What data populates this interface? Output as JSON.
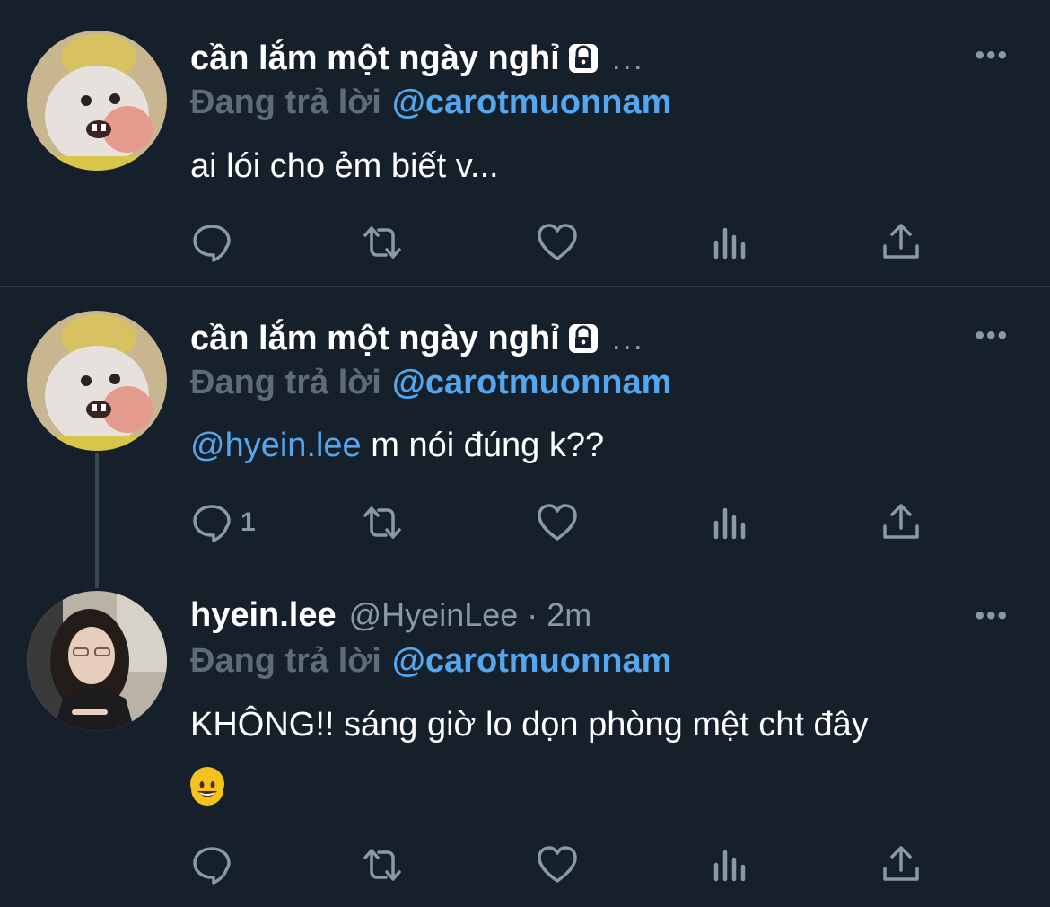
{
  "tweets": [
    {
      "name": "cần lắm một ngày nghỉ",
      "meta": "...",
      "reply_label": "Đang trả lời",
      "reply_handle": "@carotmuonnam",
      "mention": "",
      "text": "ai lói cho ẻm biết v...",
      "reply_count": ""
    },
    {
      "name": "cần lắm một ngày nghỉ",
      "meta": "...",
      "reply_label": "Đang trả lời",
      "reply_handle": "@carotmuonnam",
      "mention": "@hyein.lee",
      "text": "m nói đúng k??",
      "reply_count": "1"
    },
    {
      "name": "hyein.lee",
      "handle": "@HyeinLee · 2m",
      "reply_label": "Đang trả lời",
      "reply_handle": "@carotmuonnam",
      "text": "KHÔNG!! sáng giờ lo dọn phòng mệt cht đây",
      "reply_count": ""
    }
  ],
  "more_label": "•••",
  "icons": {
    "lock": "lock-icon",
    "reply": "reply-icon",
    "retweet": "retweet-icon",
    "like": "heart-icon",
    "views": "analytics-icon",
    "share": "share-icon",
    "emoji": "smiley-emoji"
  },
  "colors": {
    "background": "#16202b",
    "link": "#54a7ee",
    "muted": "#8b98a5",
    "reply_label": "#5f6b77"
  }
}
